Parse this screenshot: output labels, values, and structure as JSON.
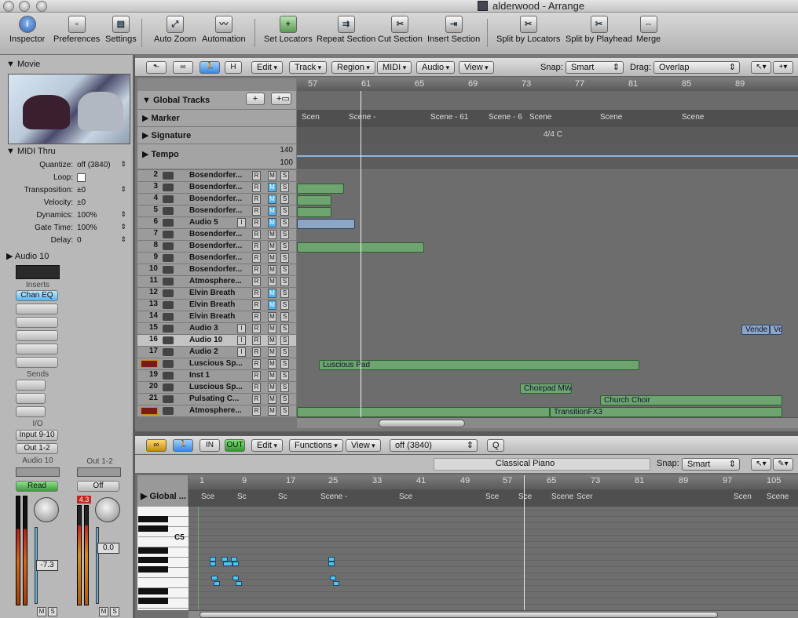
{
  "window": {
    "title": "alderwood - Arrange"
  },
  "toolbar": {
    "items": [
      "Inspector",
      "Preferences",
      "Settings",
      "Auto Zoom",
      "Automation",
      "Set Locators",
      "Repeat Section",
      "Cut Section",
      "Insert Section",
      "Split by Locators",
      "Split by Playhead",
      "Merge"
    ]
  },
  "inspector": {
    "movie_label": "Movie",
    "midi_thru_label": "MIDI Thru",
    "params": [
      {
        "label": "Quantize:",
        "value": "off (3840)"
      },
      {
        "label": "Loop:",
        "value": ""
      },
      {
        "label": "Transposition:",
        "value": "±0"
      },
      {
        "label": "Velocity:",
        "value": "±0"
      },
      {
        "label": "Dynamics:",
        "value": "100%"
      },
      {
        "label": "Gate Time:",
        "value": "100%"
      },
      {
        "label": "Delay:",
        "value": "0"
      }
    ],
    "audio_label": "Audio 10",
    "inserts_label": "Inserts",
    "chan_eq": "Chan EQ",
    "sends_label": "Sends",
    "io_label": "I/O",
    "input": "Input 9-10",
    "output": "Out 1-2",
    "strip1_name": "Audio 10",
    "strip2_name": "Out 1-2",
    "read": "Read",
    "off": "Off",
    "level1": "-7.3",
    "level2": "0.0",
    "peak2": "4.3",
    "m": "M",
    "s": "S"
  },
  "arrange_toolbar": {
    "menus": [
      "Edit",
      "Track",
      "Region",
      "MIDI",
      "Audio",
      "View"
    ],
    "h_button": "H",
    "snap_label": "Snap:",
    "snap_value": "Smart",
    "drag_label": "Drag:",
    "drag_value": "Overlap"
  },
  "ruler": [
    "57",
    "61",
    "65",
    "69",
    "73",
    "77",
    "81",
    "85",
    "89"
  ],
  "global_tracks": {
    "label": "Global Tracks",
    "marker": "Marker",
    "signature": "Signature",
    "tempo": "Tempo",
    "tempo_hi": "140",
    "tempo_lo": "100",
    "sig_value": "4/4  C",
    "markers": [
      "Scen",
      "Scene -",
      "Scene - 61",
      "Scene - 6",
      "Scene",
      "Scene",
      "Scene"
    ]
  },
  "tracks": [
    {
      "num": "2",
      "name": "Bosendorfer...",
      "i": false,
      "m_on": false
    },
    {
      "num": "3",
      "name": "Bosendorfer...",
      "i": false,
      "m_on": true
    },
    {
      "num": "4",
      "name": "Bosendorfer...",
      "i": false,
      "m_on": true
    },
    {
      "num": "5",
      "name": "Bosendorfer...",
      "i": false,
      "m_on": true
    },
    {
      "num": "6",
      "name": "Audio 5",
      "i": true,
      "m_on": true
    },
    {
      "num": "7",
      "name": "Bosendorfer...",
      "i": false,
      "m_on": false
    },
    {
      "num": "8",
      "name": "Bosendorfer...",
      "i": false,
      "m_on": false
    },
    {
      "num": "9",
      "name": "Bosendorfer...",
      "i": false,
      "m_on": false
    },
    {
      "num": "10",
      "name": "Bosendorfer...",
      "i": false,
      "m_on": false
    },
    {
      "num": "11",
      "name": "Atmosphere...",
      "i": false,
      "m_on": false
    },
    {
      "num": "12",
      "name": "Elvin Breath",
      "i": false,
      "m_on": true
    },
    {
      "num": "13",
      "name": "Elvin Breath",
      "i": false,
      "m_on": true
    },
    {
      "num": "14",
      "name": "Elvin Breath",
      "i": false,
      "m_on": false
    },
    {
      "num": "15",
      "name": "Audio 3",
      "i": true,
      "m_on": false
    },
    {
      "num": "16",
      "name": "Audio 10",
      "i": true,
      "m_on": false
    },
    {
      "num": "17",
      "name": "Audio 2",
      "i": true,
      "m_on": false
    },
    {
      "num": "",
      "name": "Luscious Sp...",
      "i": false,
      "m_on": false
    },
    {
      "num": "19",
      "name": "Inst 1",
      "i": false,
      "m_on": false
    },
    {
      "num": "20",
      "name": "Luscious Sp...",
      "i": false,
      "m_on": false
    },
    {
      "num": "21",
      "name": "Pulsating C...",
      "i": false,
      "m_on": false
    },
    {
      "num": "",
      "name": "Atmosphere...",
      "i": false,
      "m_on": false
    }
  ],
  "track_buttons": {
    "i": "I",
    "r": "R",
    "m": "M",
    "s": "S"
  },
  "regions": {
    "luscious_pad": "Luscious Pad",
    "choirpad": "Choirpad MW",
    "church_choir": "Church Choir",
    "transition": "TransitionFX3",
    "vende": "Vende",
    "ve": "Ve"
  },
  "editor": {
    "menus": [
      "Edit",
      "Functions",
      "View"
    ],
    "quantize": "off (3840)",
    "q": "Q",
    "region_name": "Classical Piano",
    "snap_label": "Snap:",
    "snap_value": "Smart",
    "global_label": "Global ...",
    "c5": "C5",
    "ruler": [
      "1",
      "9",
      "17",
      "25",
      "33",
      "41",
      "49",
      "57",
      "65",
      "73",
      "81",
      "89",
      "97",
      "105"
    ],
    "markers": [
      "Sce",
      "Sc",
      "Sc",
      "Sc",
      "Sc",
      "Scene -",
      "Sce",
      "Sc",
      "Sce",
      "Sc",
      "Sc",
      "Sce",
      "Sce",
      "Sce",
      "Scene",
      "Scer",
      "Sc",
      "Sc",
      "Sc",
      "Sc",
      "Scen",
      "Scene"
    ]
  }
}
